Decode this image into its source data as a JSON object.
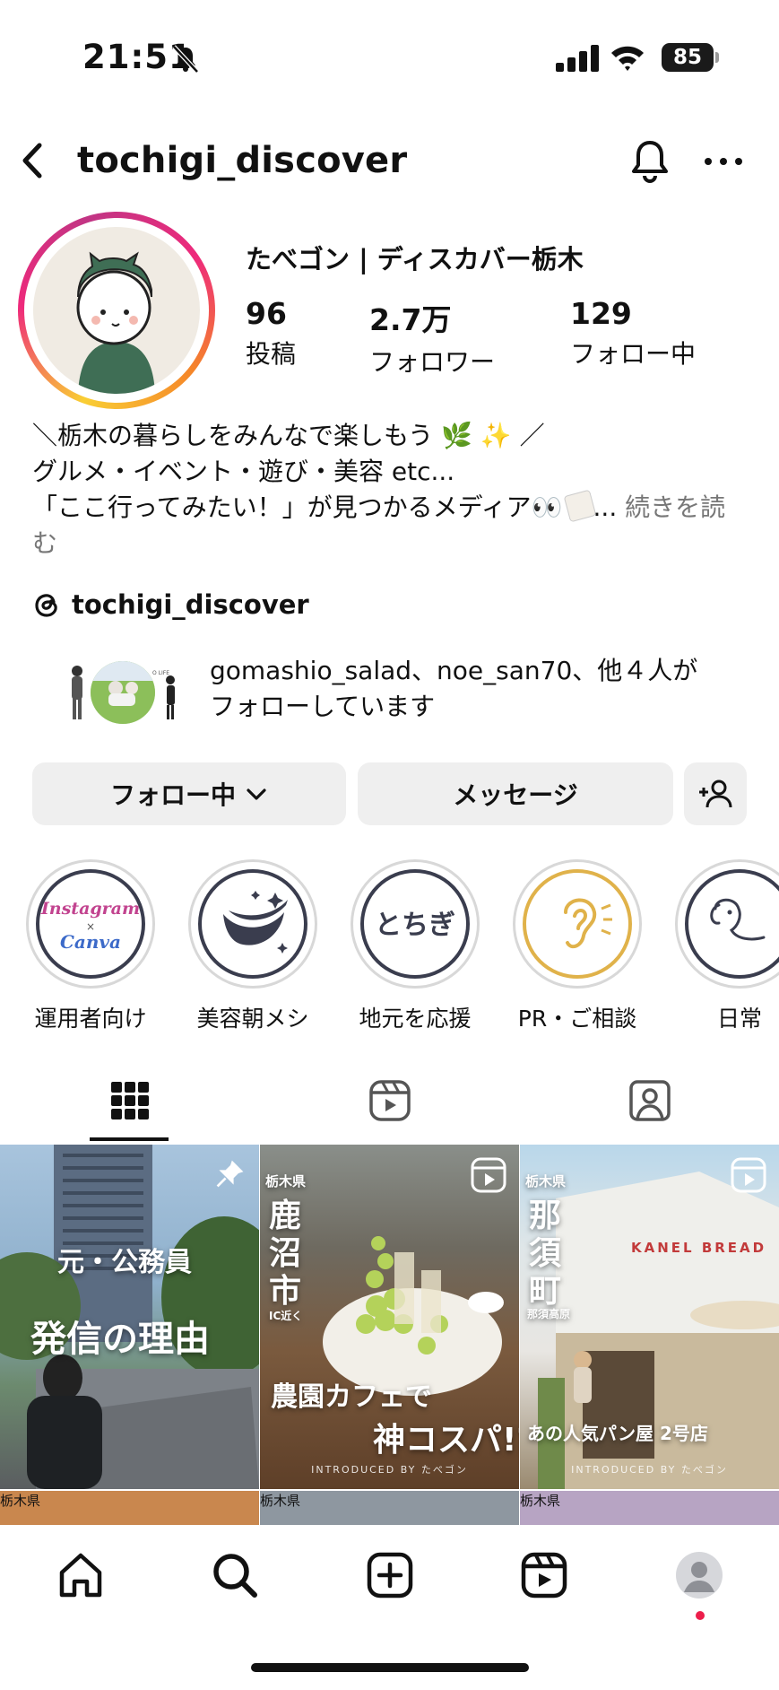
{
  "status_bar": {
    "time": "21:51",
    "battery": "85",
    "icons": [
      "bell-slash-icon",
      "cellular-signal-icon",
      "wifi-icon",
      "battery-icon"
    ]
  },
  "header": {
    "username": "tochigi_discover",
    "icons": [
      "chevron-left-icon",
      "bell-icon",
      "more-horizontal-icon"
    ]
  },
  "profile": {
    "display_name": "たべゴン | ディスカバー栃木",
    "stats": [
      {
        "value": "96",
        "label": "投稿"
      },
      {
        "value": "2.7万",
        "label": "フォロワー"
      },
      {
        "value": "129",
        "label": "フォロー中"
      }
    ],
    "bio_line1": "＼栃木の暮らしをみんなで楽しもう 🌿 ✨ ／",
    "bio_line2": "グルメ・イベント・遊び・美容 etc...",
    "bio_line3": "「ここ行ってみたい！」が見つかるメディア👀",
    "bio_ellipsis": "... ",
    "bio_more": "続きを読",
    "bio_more2": "む",
    "threads_handle": "tochigi_discover",
    "followed_by_line1": "gomashio_salad、noe_san70、他４人が",
    "followed_by_line2": "フォローしています"
  },
  "buttons": {
    "following": "フォロー中",
    "message": "メッセージ"
  },
  "highlights": [
    {
      "label": "運用者向け",
      "cover_text1": "Instagram",
      "cover_text2": "×",
      "cover_text3": "Canva"
    },
    {
      "label": "美容朝メシ"
    },
    {
      "label": "地元を応援",
      "cover_text1": "とちぎ"
    },
    {
      "label": "PR・ご相談"
    },
    {
      "label": "日常"
    }
  ],
  "tabs": [
    "grid-icon",
    "reels-icon",
    "tagged-icon"
  ],
  "posts": [
    {
      "line1": "元・公務員",
      "line2": "発信の理由",
      "pinned": true
    },
    {
      "pref": "栃木県",
      "place": [
        "鹿",
        "沼",
        "市"
      ],
      "sub": "IC近く",
      "line1": "農園カフェで",
      "line2": "神コスパ!?",
      "footer": "INTRODUCED BY たべゴン"
    },
    {
      "pref": "栃木県",
      "place": [
        "那",
        "須",
        "町"
      ],
      "sub": "那須高原",
      "sign": "KANEL BREAD",
      "line1": "あの人気パン屋 2号店",
      "footer": "INTRODUCED BY たべゴン"
    }
  ],
  "bottom_row_labels": [
    "栃木県",
    "栃木県",
    "栃木県"
  ],
  "bottom_nav": [
    "home-icon",
    "search-icon",
    "create-icon",
    "reels-icon",
    "profile-avatar"
  ],
  "colors": {
    "button_bg": "#efefef",
    "accent_dot": "#ed1e4b",
    "highlight_ring": "#d8d8d8"
  }
}
